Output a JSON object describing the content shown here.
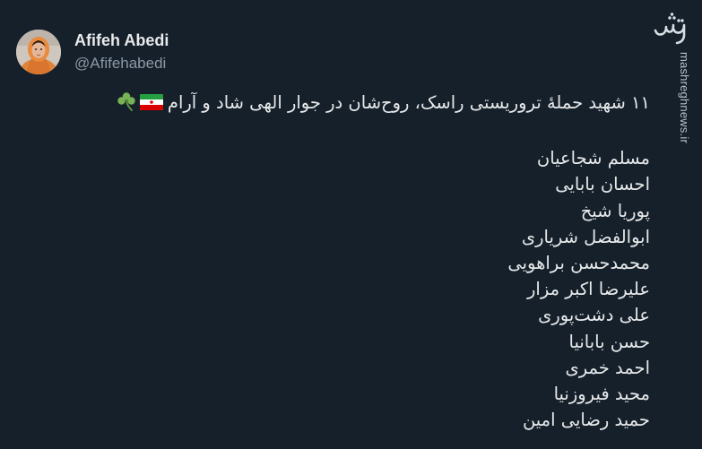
{
  "author": {
    "display_name": "Afifeh Abedi",
    "handle": "@Afifehabedi"
  },
  "tweet": {
    "headline": "۱۱ شهید حملهٔ تروریستی راسک، روح‌شان در جوار الهی شاد و آرام",
    "names": [
      "مسلم شجاعیان",
      "احسان بابایی",
      "پوریا شیخ",
      "ابوالفضل شریاری",
      "محمدحسن براهویی",
      "علیرضا اکبر مزار",
      "علی دشت‌پوری",
      "حسن بابانیا",
      "احمد خمری",
      "محید فیروزنیا",
      "حمید رضایی امین"
    ],
    "emoji": [
      "iran-flag",
      "shamrock"
    ]
  },
  "watermark": {
    "logo_text": "مشرق",
    "url": "mashreghnews.ir"
  },
  "colors": {
    "background": "#15202b",
    "text": "#e7e9ea",
    "secondary": "#8b98a5"
  }
}
